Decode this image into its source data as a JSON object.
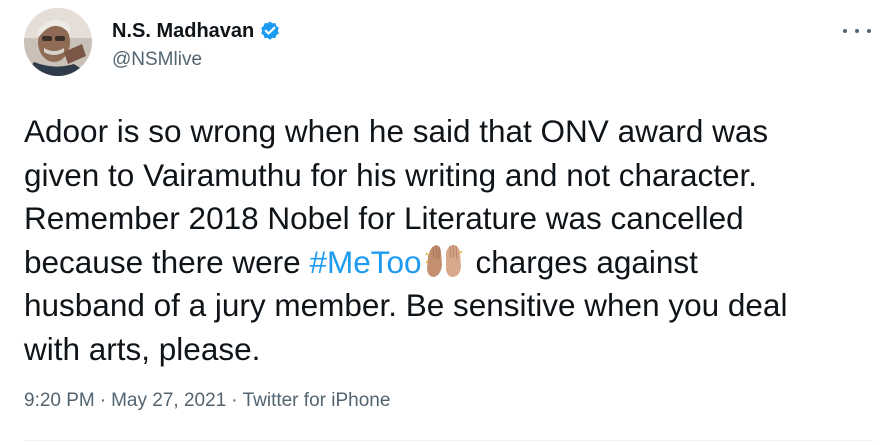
{
  "author": {
    "display_name": "N.S. Madhavan",
    "handle": "@NSMlive",
    "verified": true
  },
  "tweet": {
    "lines": [
      "Adoor is so wrong when he said that ONV award was",
      "given to Vairamuthu for his writing and not character.",
      "Remember 2018 Nobel for Literature was cancelled"
    ],
    "line4_before": "because there were ",
    "hashtag": "#MeToo",
    "emoji_icon": "raised-hands-icon",
    "line4_after": "charges against",
    "line5": "husband of a jury member. Be sensitive when you deal",
    "line6": "with arts, please."
  },
  "meta": {
    "time": "9:20 PM",
    "separator": "·",
    "date": "May 27, 2021",
    "source": "Twitter for iPhone"
  },
  "icons": {
    "verified": "verified-badge-icon",
    "more": "more-options-icon"
  },
  "colors": {
    "accent": "#1d9bf0",
    "text": "#0f1419",
    "secondary": "#536471"
  }
}
